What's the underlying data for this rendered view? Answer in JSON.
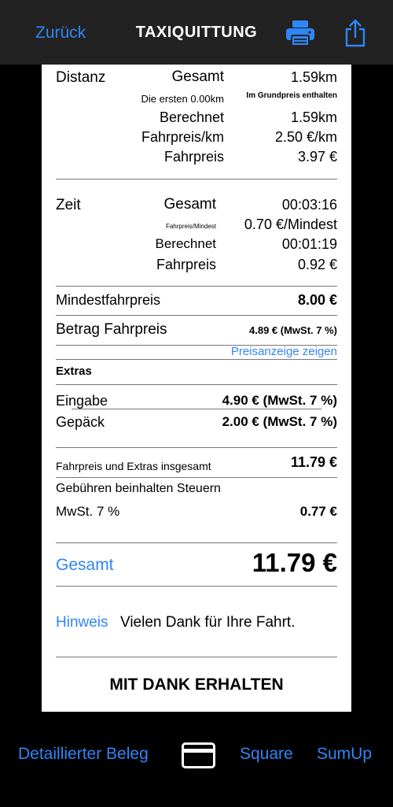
{
  "nav": {
    "back": "Zurück",
    "title": "TAXIQUITTUNG",
    "print_icon": "printer-icon",
    "share_icon": "share-icon"
  },
  "distance": {
    "label": "Distanz",
    "total_label": "Gesamt",
    "total_value": "1.59km",
    "first_label": "Die ersten 0.00km",
    "first_value": "Im Grundpreis enthalten",
    "charged_label": "Berechnet",
    "charged_value": "1.59km",
    "rate_label": "Fahrpreis/km",
    "rate_value": "2.50 €/km",
    "fare_label": "Fahrpreis",
    "fare_value": "3.97 €"
  },
  "time": {
    "label": "Zeit",
    "total_label": "Gesamt",
    "total_value": "00:03:16",
    "rate_label": "Fahrpreis/Mindest",
    "rate_value": "0.70 €/Mindest",
    "charged_label": "Berechnet",
    "charged_value": "00:01:19",
    "fare_label": "Fahrpreis",
    "fare_value": "0.92 €"
  },
  "minimum": {
    "label": "Mindestfahrpreis",
    "value": "8.00 €"
  },
  "fare_amount": {
    "label": "Betrag Fahrpreis",
    "value": "4.89 € (MwSt. 7 %)",
    "link": "Preisanzeige zeigen"
  },
  "extras": {
    "heading": "Extras",
    "items": [
      {
        "label": "Eingabe",
        "value": "4.90 € (MwSt. 7 %)"
      },
      {
        "label": "Gepäck",
        "value": "2.00 € (MwSt. 7 %)"
      }
    ]
  },
  "subtotal": {
    "label": "Fahrpreis und Extras insgesamt",
    "value": "11.79 €"
  },
  "taxes": {
    "heading": "Gebühren beinhalten Steuern",
    "label": "MwSt. 7 %",
    "value": "0.77 €"
  },
  "total": {
    "label": "Gesamt",
    "value": "11.79 €"
  },
  "note": {
    "label": "Hinweis",
    "text": "Vielen Dank für Ihre Fahrt."
  },
  "received": "MIT DANK ERHALTEN",
  "bottom": {
    "detailed": "Detaillierter Beleg",
    "card_icon": "credit-card-icon",
    "square": "Square",
    "sumup": "SumUp"
  },
  "colors": {
    "accent": "#2f86f6",
    "navbar": "#222222",
    "background": "#000000",
    "receipt": "#ffffff"
  }
}
